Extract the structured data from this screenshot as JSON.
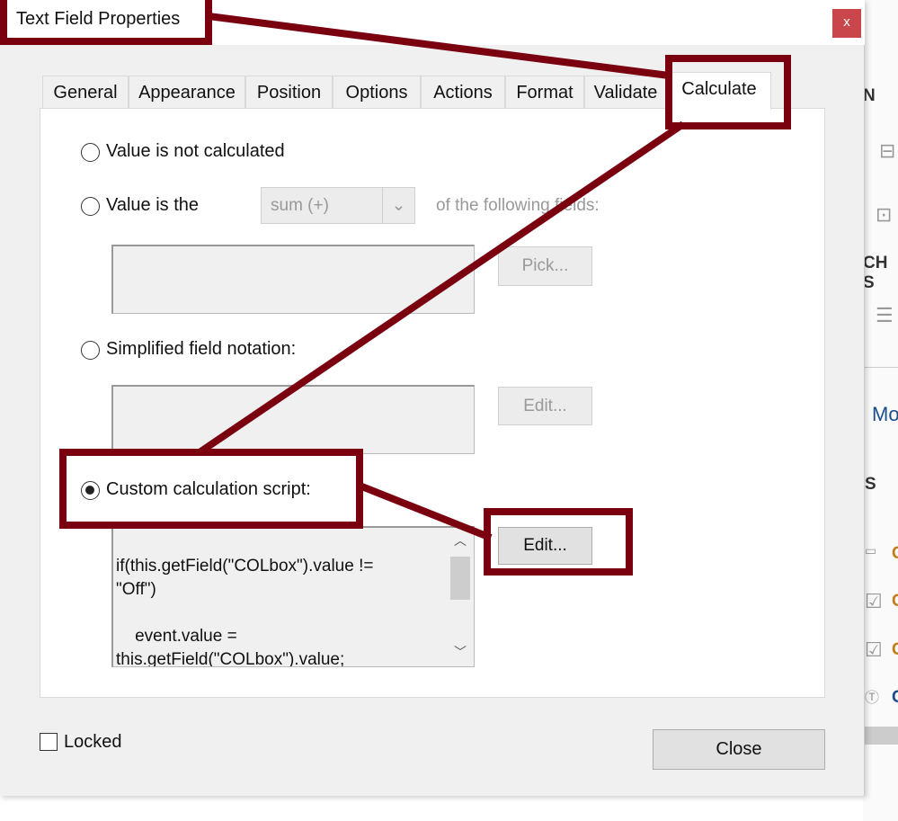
{
  "background": {
    "fragments": [
      "N",
      "CH S",
      "Mo",
      "S",
      "C",
      "C",
      "C",
      "C"
    ]
  },
  "dialog": {
    "title": "Text Field Properties",
    "close_glyph": "x",
    "tabs": [
      {
        "label": "General"
      },
      {
        "label": "Appearance"
      },
      {
        "label": "Position"
      },
      {
        "label": "Options"
      },
      {
        "label": "Actions"
      },
      {
        "label": "Format"
      },
      {
        "label": "Validate"
      },
      {
        "label": "Calculate",
        "selected": true
      }
    ],
    "calculate": {
      "opt_not_calculated": "Value is not calculated",
      "opt_value_is": "Value is the",
      "operation_select": "sum (+)",
      "of_following": "of the following fields:",
      "pick_button": "Pick...",
      "opt_simplified": "Simplified field notation:",
      "edit_simplified_button": "Edit...",
      "opt_custom": "Custom calculation script:",
      "selected_option": "custom",
      "script": "if(this.getField(\"COLbox\").value != \n\"Off\")\n\n    event.value = \nthis.getField(\"COLbox\").value;",
      "edit_script_button": "Edit..."
    },
    "locked_label": "Locked",
    "locked_checked": false,
    "close_button": "Close"
  },
  "annotation_color": "#7a0010"
}
